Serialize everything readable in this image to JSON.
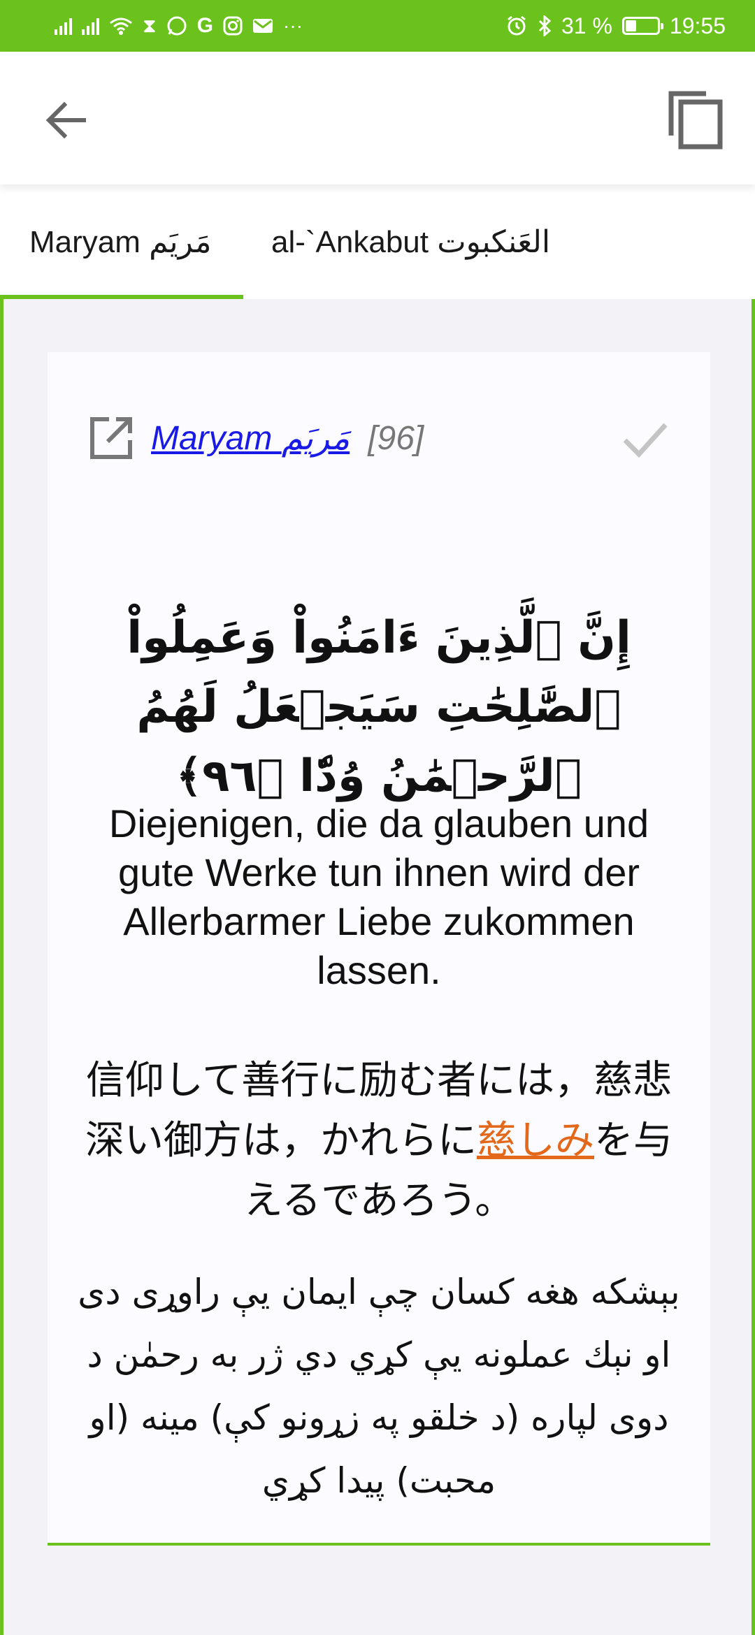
{
  "status_bar": {
    "battery_text": "31 %",
    "battery_level": 0.31,
    "time": "19:55",
    "more_indicator": "···",
    "left_icons": [
      "signal-icon",
      "signal-icon",
      "wifi-icon",
      "hourglass-icon",
      "whatsapp-icon",
      "google-icon",
      "instagram-icon",
      "mail-icon"
    ],
    "right_icons": [
      "alarm-icon",
      "bluetooth-icon"
    ],
    "bar_color": "#6cc21c"
  },
  "toolbar": {
    "back_icon": "arrow-left-icon",
    "copy_icon": "copy-icon"
  },
  "tabs": [
    {
      "label": "Maryam مَريَم",
      "active": true
    },
    {
      "label": "al-`Ankabut العَنكبوت",
      "active": false
    }
  ],
  "card": {
    "surah_link": "Maryam مَريَم",
    "ayah_number": "[96]",
    "arabic_text": "إِنَّ ٱلَّذِينَ ءَامَنُواْ وَعَمِلُواْ ٱلصَّٰلِحَٰتِ سَيَجۡعَلُ لَهُمُ ٱلرَّحۡمَٰنُ وُدّٗا ﴿٩٦﴾",
    "translation_de": "Diejenigen, die da glauben und gute Werke tun ihnen wird der Allerbarmer Liebe zukommen lassen.",
    "translation_ja_before": "信仰して善行に励む者には，慈悲深い御方は，かれらに",
    "translation_ja_link": "慈しみ",
    "translation_ja_after": "を与えるであろう。",
    "translation_ps": "بېشکه هغه کسان چې ایمان يې راوړی دی او نېك عملونه يې کړي دي ژر به رحمٰن د دوی لپاره (د خلقو په زړونو کې) مینه (او محبت) پیدا کړي"
  },
  "colors": {
    "accent": "#6cc21c",
    "link": "#1a1ae6",
    "highlight_link": "#e4681a"
  }
}
